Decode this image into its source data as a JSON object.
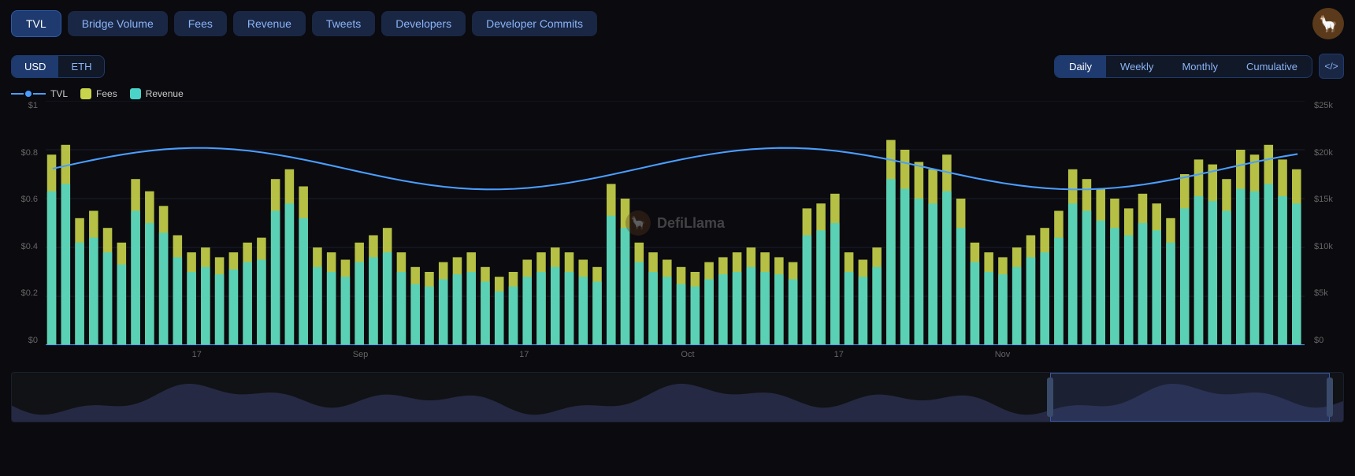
{
  "nav": {
    "buttons": [
      {
        "label": "TVL",
        "active": true
      },
      {
        "label": "Bridge Volume",
        "active": false
      },
      {
        "label": "Fees",
        "active": false
      },
      {
        "label": "Revenue",
        "active": false
      },
      {
        "label": "Tweets",
        "active": false
      },
      {
        "label": "Developers",
        "active": false
      },
      {
        "label": "Developer Commits",
        "active": false
      }
    ]
  },
  "currency": {
    "options": [
      {
        "label": "USD",
        "active": true
      },
      {
        "label": "ETH",
        "active": false
      }
    ]
  },
  "period": {
    "options": [
      {
        "label": "Daily",
        "active": true
      },
      {
        "label": "Weekly",
        "active": false
      },
      {
        "label": "Monthly",
        "active": false
      },
      {
        "label": "Cumulative",
        "active": false
      }
    ]
  },
  "embed_btn_label": "</>",
  "legend": [
    {
      "label": "TVL",
      "type": "line",
      "color": "#4a9eff"
    },
    {
      "label": "Fees",
      "type": "bar",
      "color": "#c8d44a"
    },
    {
      "label": "Revenue",
      "type": "bar",
      "color": "#4ad4c8"
    }
  ],
  "y_axis_left": [
    "$1",
    "$0.8",
    "$0.6",
    "$0.4",
    "$0.2",
    "$0"
  ],
  "y_axis_right": [
    "$25k",
    "$20k",
    "$15k",
    "$10k",
    "$5k",
    "$0"
  ],
  "x_labels": [
    {
      "label": "17",
      "pct": 12
    },
    {
      "label": "Sep",
      "pct": 25
    },
    {
      "label": "17",
      "pct": 38
    },
    {
      "label": "Oct",
      "pct": 51
    },
    {
      "label": "17",
      "pct": 63
    },
    {
      "label": "Nov",
      "pct": 76
    }
  ],
  "watermark": "DefiLlama",
  "overview": {
    "selection_left_pct": 78,
    "selection_right_pct": 99
  }
}
